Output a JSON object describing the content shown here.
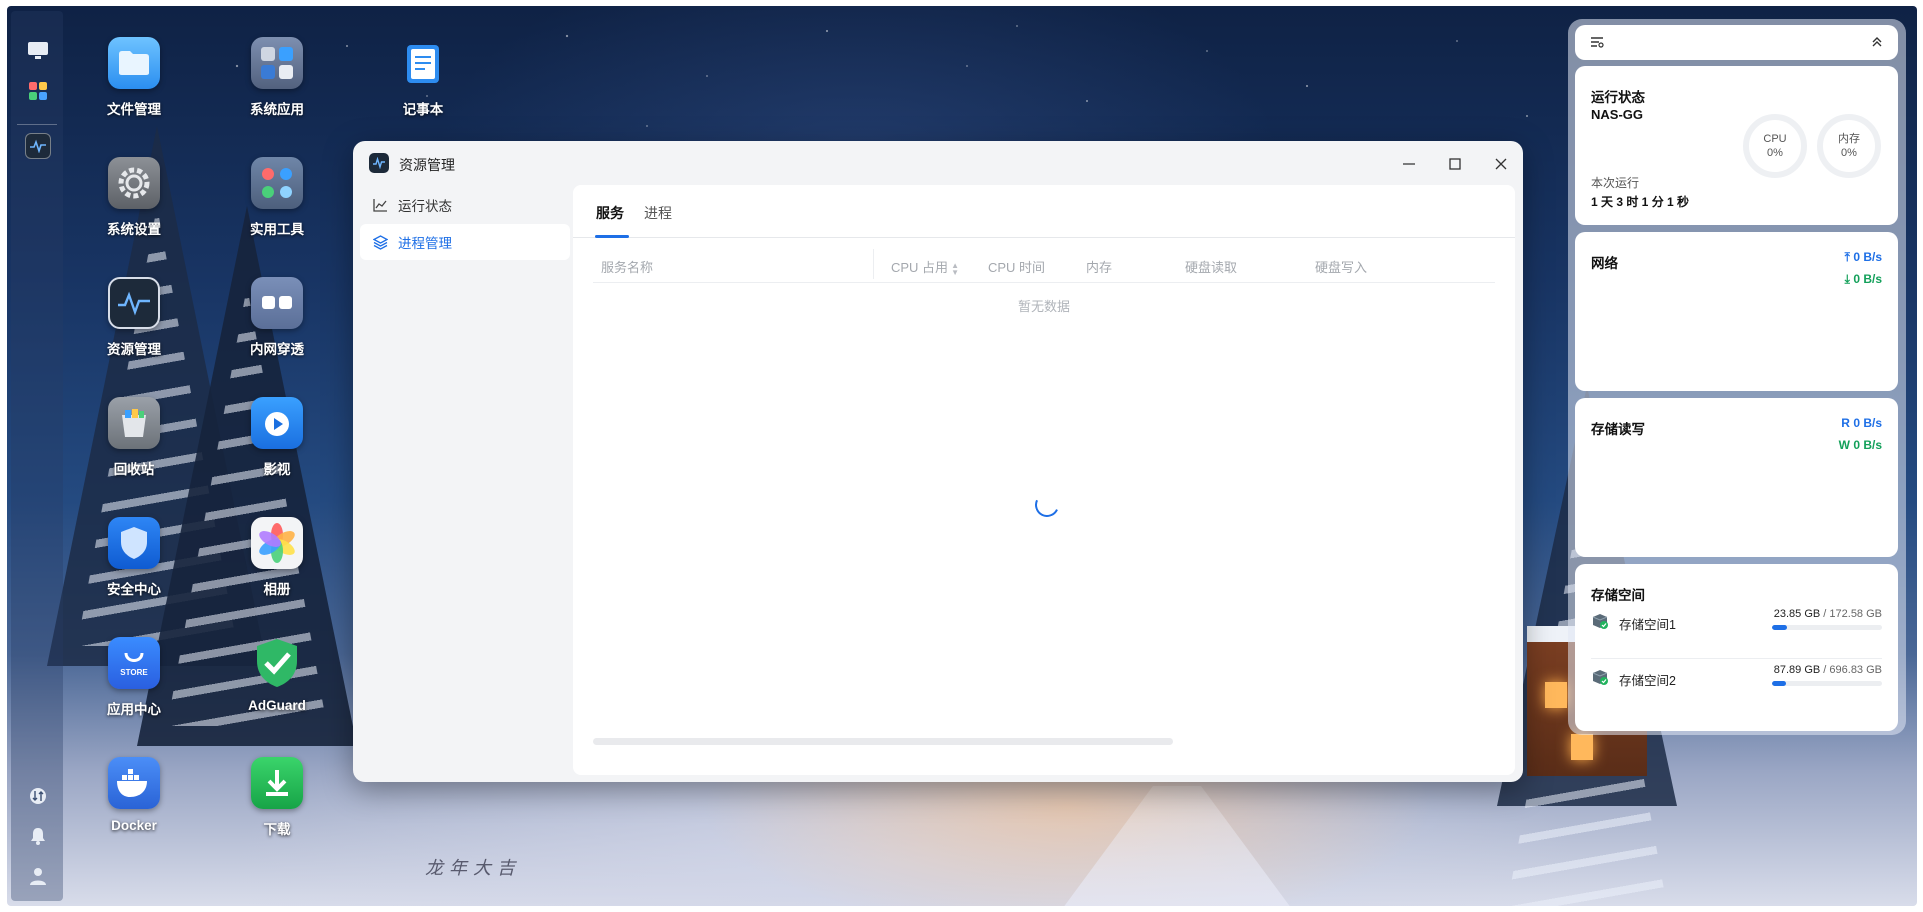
{
  "desktop": {
    "greeting": "龙年大吉",
    "apps": [
      {
        "label": "文件管理",
        "icon": "folder-icon"
      },
      {
        "label": "系统应用",
        "icon": "system-apps-icon"
      },
      {
        "label": "记事本",
        "icon": "notepad-icon"
      },
      {
        "label": "系统设置",
        "icon": "settings-gear-icon"
      },
      {
        "label": "实用工具",
        "icon": "utilities-icon"
      },
      {
        "label": "资源管理",
        "icon": "resource-monitor-icon"
      },
      {
        "label": "内网穿透",
        "icon": "tunnel-icon"
      },
      {
        "label": "回收站",
        "icon": "recycle-bin-icon"
      },
      {
        "label": "影视",
        "icon": "video-icon"
      },
      {
        "label": "安全中心",
        "icon": "security-shield-icon"
      },
      {
        "label": "相册",
        "icon": "photos-icon"
      },
      {
        "label": "应用中心",
        "icon": "app-store-icon"
      },
      {
        "label": "AdGuard",
        "icon": "adguard-icon"
      },
      {
        "label": "Docker",
        "icon": "docker-icon"
      },
      {
        "label": "下载",
        "icon": "download-icon"
      }
    ],
    "store_text": "STORE"
  },
  "window": {
    "title": "资源管理",
    "sidebar": [
      {
        "label": "运行状态",
        "icon": "line-chart-icon"
      },
      {
        "label": "进程管理",
        "icon": "layers-icon"
      }
    ],
    "tabs": [
      "服务",
      "进程"
    ],
    "columns": [
      "服务名称",
      "CPU 占用",
      "CPU 时间",
      "内存",
      "硬盘读取",
      "硬盘写入"
    ],
    "empty_text": "暂无数据"
  },
  "widgets": {
    "status": {
      "title": "运行状态",
      "hostname": "NAS-GG",
      "cpu_label": "CPU",
      "cpu_value": "0%",
      "mem_label": "内存",
      "mem_value": "0%",
      "uptime_label": "本次运行",
      "uptime_value": "1 天 3 时 1 分 1 秒"
    },
    "network": {
      "title": "网络",
      "up": "0 B/s",
      "down": "0 B/s"
    },
    "disk_io": {
      "title": "存储读写",
      "read_label": "R",
      "read": "0 B/s",
      "write_label": "W",
      "write": "0 B/s"
    },
    "storage": {
      "title": "存储空间",
      "volumes": [
        {
          "name": "存储空间1",
          "used": "23.85 GB",
          "total": "172.58 GB",
          "fraction": 0.138
        },
        {
          "name": "存储空间2",
          "used": "87.89 GB",
          "total": "696.83 GB",
          "fraction": 0.126
        }
      ]
    }
  },
  "colors": {
    "accent": "#1e6fe6",
    "green": "#13a05a"
  }
}
